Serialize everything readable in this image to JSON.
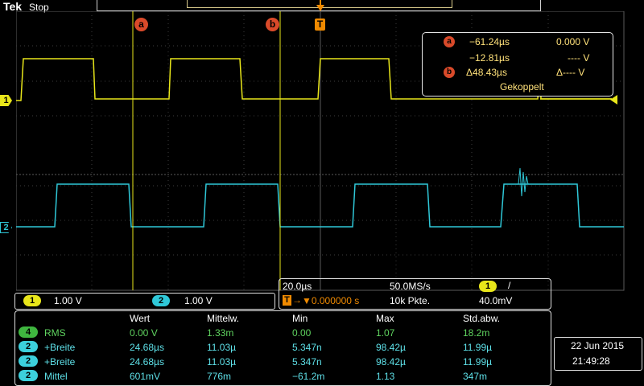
{
  "header": {
    "brand": "Tek",
    "state": "Stop"
  },
  "markers": {
    "a": "a",
    "b": "b",
    "trigger": "T",
    "channel1": "1",
    "channel2": "2"
  },
  "cursor_readout": {
    "row1": {
      "marker": "a",
      "time": "−61.24µs",
      "volt": "0.000 V"
    },
    "row2": {
      "time": "−12.81µs",
      "volt": "---- V"
    },
    "row3": {
      "marker": "b",
      "time": "Δ48.43µs",
      "volt": "Δ---- V"
    },
    "mode": "Gekoppelt"
  },
  "scale": {
    "ch1_badge": "1",
    "ch1_value": "1.00 V",
    "ch2_badge": "2",
    "ch2_value": "1.00 V"
  },
  "timebase": {
    "horizontal": "20.0µs",
    "rate": "50.0MS/s",
    "trig_source": "1",
    "trig_slope": "/",
    "trig_pos": "▼0.000000 s",
    "record": "10k Pkte.",
    "trig_level": "40.0mV",
    "trig_badge": "T",
    "trig_arrow": "→"
  },
  "measurements": {
    "headers": [
      "Wert",
      "Mittelw.",
      "Min",
      "Max",
      "Std.abw."
    ],
    "rows": [
      {
        "ch": "4",
        "name": "RMS",
        "color": "#5fd35f",
        "badge_color": "#3fb63f",
        "values": [
          "0.00 V",
          "1.33m",
          "0.00",
          "1.07",
          "18.2m"
        ]
      },
      {
        "ch": "2",
        "name": "+Breite",
        "color": "#5ee0e8",
        "badge_color": "#3cd0dc",
        "values": [
          "24.68µs",
          "11.03µ",
          "5.347n",
          "98.42µ",
          "11.99µ"
        ]
      },
      {
        "ch": "2",
        "name": "+Breite",
        "color": "#5ee0e8",
        "badge_color": "#3cd0dc",
        "values": [
          "24.68µs",
          "11.03µ",
          "5.347n",
          "98.42µ",
          "11.99µ"
        ]
      },
      {
        "ch": "2",
        "name": "Mittel",
        "color": "#5ee0e8",
        "badge_color": "#3cd0dc",
        "values": [
          "601mV",
          "776m",
          "−61.2m",
          "1.13",
          "347m"
        ]
      }
    ]
  },
  "datetime": {
    "date": "22 Jun  2015",
    "time": "21:49:28"
  },
  "colors": {
    "ch1": "#e8e61a",
    "ch2": "#2fc8d8",
    "cursor": "#e8e61a",
    "marker": "#d94a2a",
    "trigger": "#f08a00",
    "grid": "#5a5a5a"
  }
}
